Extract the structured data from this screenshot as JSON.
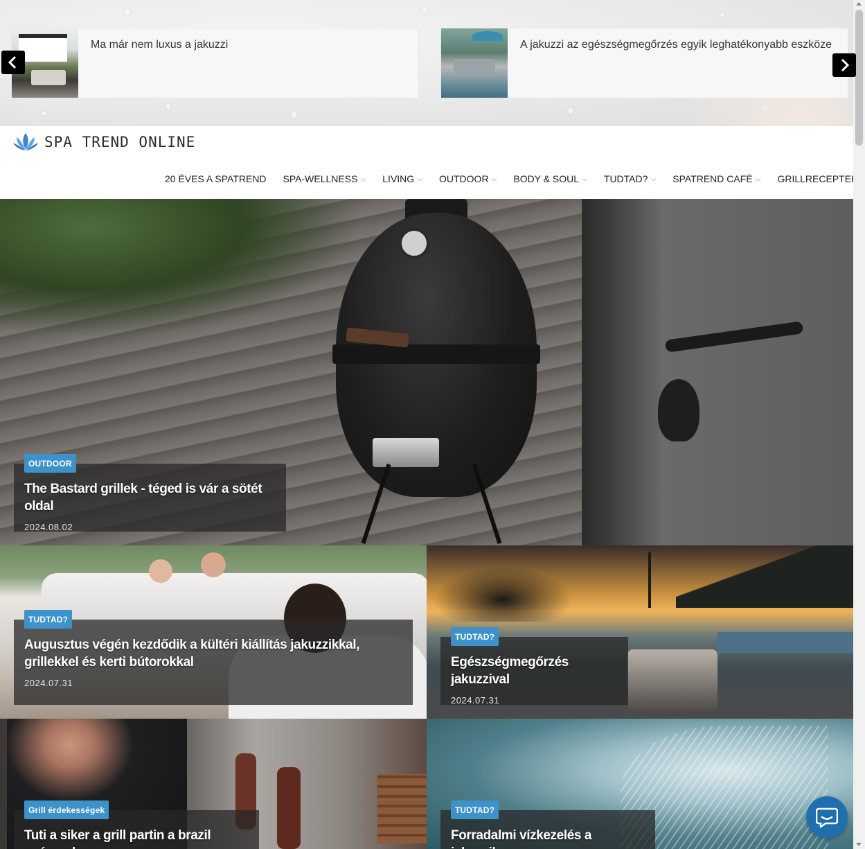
{
  "carousel": {
    "items": [
      {
        "title": "Ma már nem luxus a jakuzzi"
      },
      {
        "title": "A jakuzzi az egészségmegőrzés egyik leghatékonyabb eszköze"
      }
    ],
    "prev_icon": "chevron-left-icon",
    "next_icon": "chevron-right-icon"
  },
  "header": {
    "logo_text": "SPA TREND ONLINE",
    "nav": [
      {
        "label": "20 ÉVES A SPATREND",
        "has_dropdown": false
      },
      {
        "label": "SPA-WELLNESS",
        "has_dropdown": true
      },
      {
        "label": "LIVING",
        "has_dropdown": true
      },
      {
        "label": "OUTDOOR",
        "has_dropdown": true
      },
      {
        "label": "BODY & SOUL",
        "has_dropdown": true
      },
      {
        "label": "TUDTAD?",
        "has_dropdown": true
      },
      {
        "label": "SPATREND CAFÉ",
        "has_dropdown": true
      },
      {
        "label": "GRILLRECEPTEK",
        "has_dropdown": true
      }
    ],
    "dropdown_glyph": "⌵"
  },
  "articles": {
    "hero": {
      "category": "OUTDOOR",
      "title": "The Bastard grillek - téged is vár a sötét oldal",
      "date": "2024.08.02"
    },
    "a2": {
      "category": "TUDTAD?",
      "title": "Augusztus végén kezdődik a kültéri kiállítás jakuzzikkal, grillekkel és kerti bútorokkal",
      "date": "2024.07.31"
    },
    "a3": {
      "category": "TUDTAD?",
      "title": "Egészségmegőrzés jakuzzival",
      "date": "2024.07.31"
    },
    "a4": {
      "category": "Grill érdekességek",
      "title": "Tuti a siker a grill partin a brazil nyárssal"
    },
    "a5": {
      "category": "TUDTAD?",
      "title": "Forradalmi vízkezelés a jakuzziban"
    }
  },
  "colors": {
    "badge": "#3d93c9",
    "chat_button": "#1f6fae",
    "logo_blue": "#3a86c8"
  },
  "chat": {
    "icon": "chat-bubble-icon"
  }
}
